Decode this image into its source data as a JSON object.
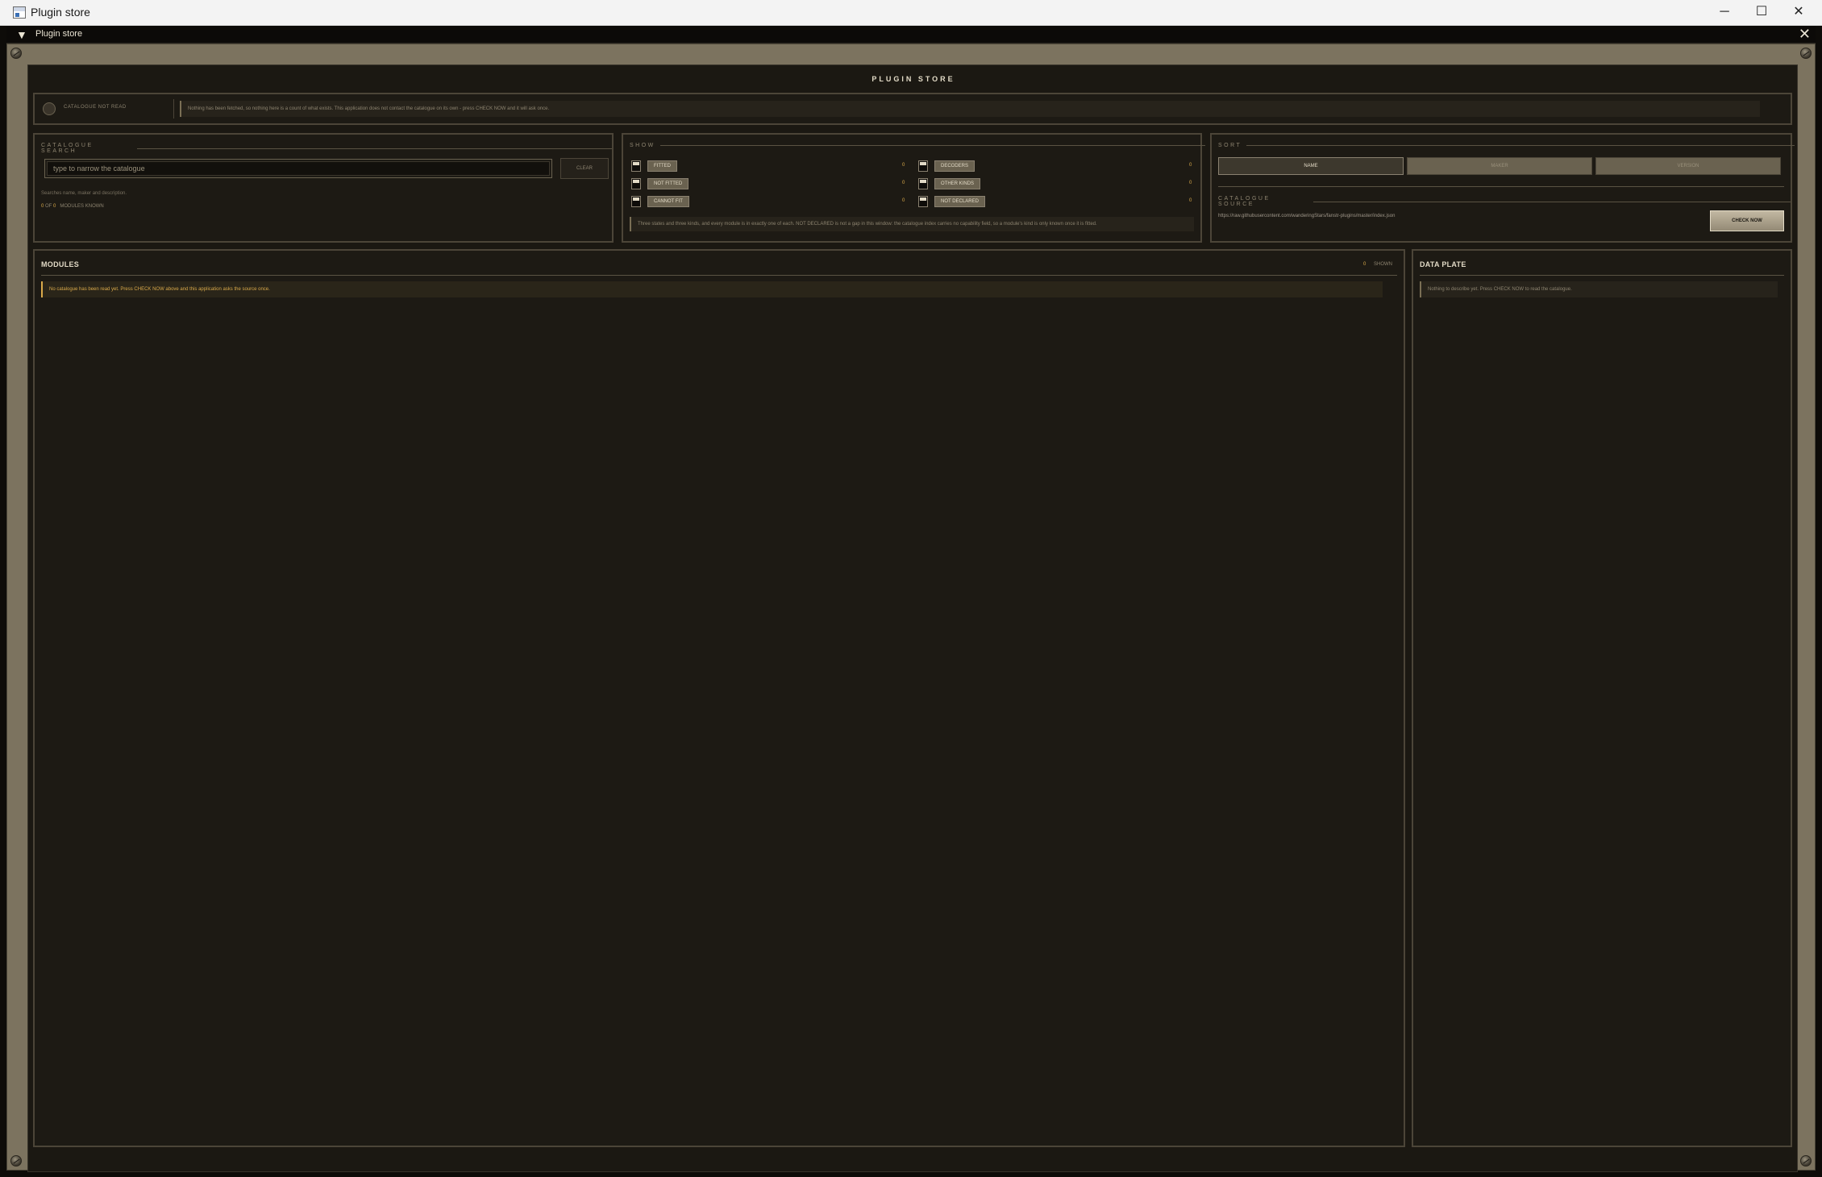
{
  "os": {
    "title": "Plugin store",
    "minimize": "─",
    "maximize": "☐",
    "close": "✕"
  },
  "window": {
    "title": "Plugin store",
    "menu_glyph": "▼",
    "close_glyph": "✕"
  },
  "store": {
    "title": "PLUGIN STORE"
  },
  "status": {
    "label": "CATALOGUE NOT READ",
    "message": "Nothing has been fetched, so nothing here is a count of what exists. This application does not contact the catalogue on its own - press CHECK NOW and it will ask once."
  },
  "search": {
    "heading": "CATALOGUE SEARCH",
    "placeholder": "type to narrow the catalogue",
    "value": "",
    "clear_label": "CLEAR",
    "hint": "Searches name, maker and description.",
    "shown_count": "0",
    "of_label": "OF",
    "known_count": "0",
    "known_label": "MODULES KNOWN"
  },
  "show": {
    "heading": "SHOW",
    "filters_left": [
      {
        "label": "FITTED",
        "count": "0"
      },
      {
        "label": "NOT FITTED",
        "count": "0"
      },
      {
        "label": "CANNOT FIT",
        "count": "0"
      }
    ],
    "filters_right": [
      {
        "label": "DECODERS",
        "count": "0"
      },
      {
        "label": "OTHER KINDS",
        "count": "0"
      },
      {
        "label": "NOT DECLARED",
        "count": "0"
      }
    ],
    "note": "Three states and three kinds, and every module is in exactly one of each. NOT DECLARED is not a gap in this window: the catalogue index carries no capability field, so a module's kind is only known once it is fitted."
  },
  "sort": {
    "heading": "SORT",
    "options": [
      "NAME",
      "MAKER",
      "VERSION"
    ],
    "active": "NAME"
  },
  "source": {
    "heading": "CATALOGUE SOURCE",
    "url": "https://raw.githubusercontent.com/wanderingStars/fanstr-plugins/master/index.json",
    "check_label": "CHECK NOW"
  },
  "modules": {
    "heading": "MODULES",
    "shown_count": "0",
    "shown_label": "SHOWN",
    "empty_message": "No catalogue has been read yet. Press CHECK NOW above and this application asks the source once."
  },
  "data_plate": {
    "heading": "DATA PLATE",
    "empty_message": "Nothing to describe yet. Press CHECK NOW to read the catalogue."
  },
  "colors": {
    "panel": "#1b1812",
    "frame": "#7c735f",
    "accent_amber": "#d9a94a",
    "text_light": "#e2dac6",
    "text_dim": "#8d8470"
  }
}
